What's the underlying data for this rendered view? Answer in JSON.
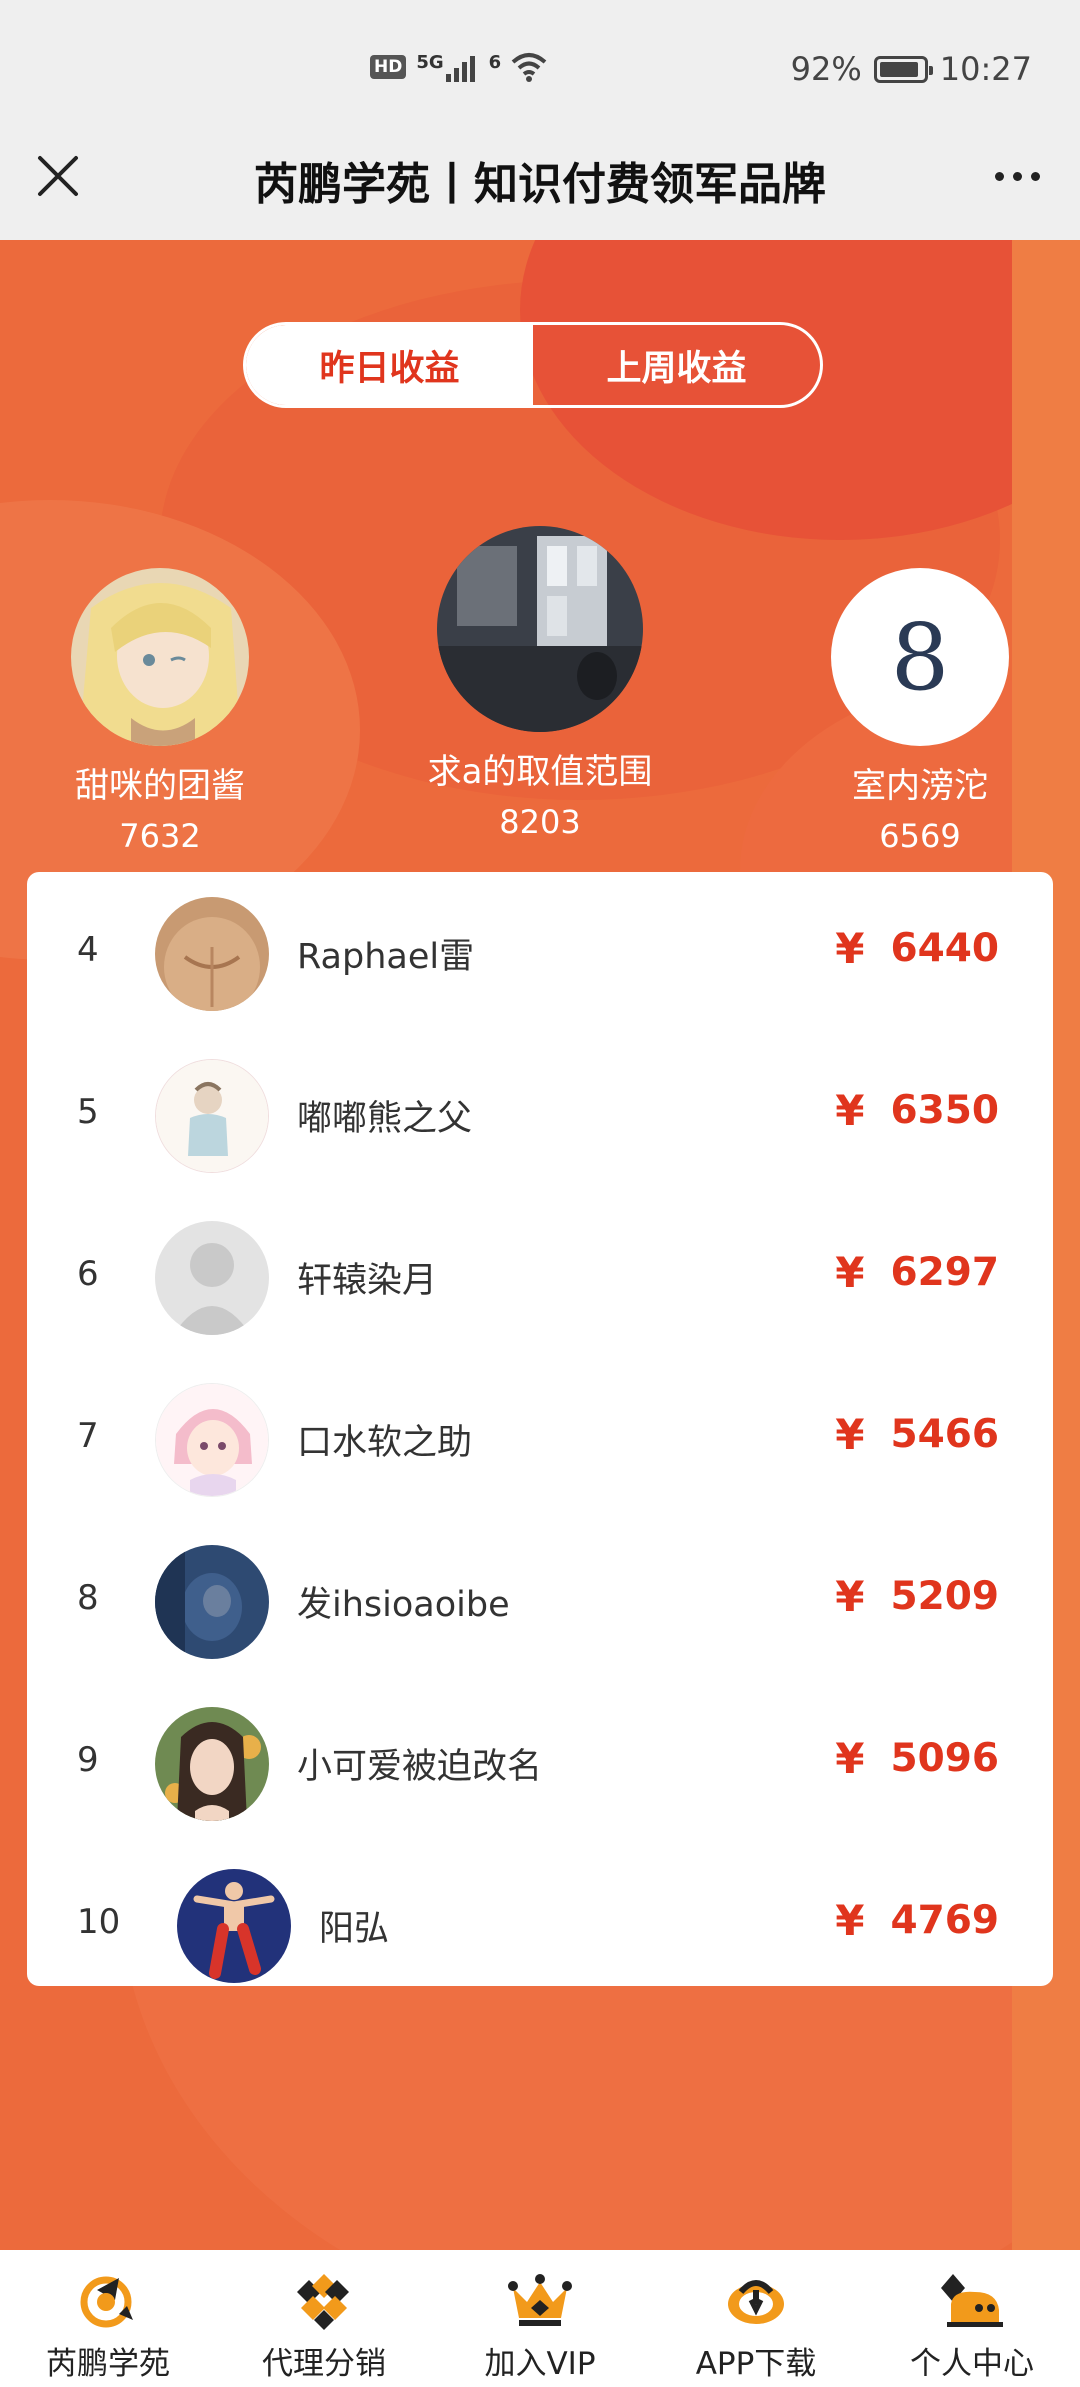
{
  "status_bar": {
    "hd": "HD",
    "network": "5G",
    "wifi": "6",
    "battery_percent": "92%",
    "battery_level": 0.92,
    "time": "10:27"
  },
  "title_bar": {
    "title": "芮鹏学苑丨知识付费领军品牌"
  },
  "tabs": [
    {
      "label": "昨日收益",
      "active": true
    },
    {
      "label": "上周收益",
      "active": false
    }
  ],
  "podium": {
    "first": {
      "name": "求a的取值范围",
      "score": "8203"
    },
    "second": {
      "name": "甜咪的团酱",
      "score": "7632"
    },
    "third": {
      "name": "室内滂沱",
      "score": "6569",
      "avatar_text": "8"
    }
  },
  "currency_symbol": "¥",
  "ranking": [
    {
      "rank": "4",
      "name": "Raphael雷",
      "amount": "6440"
    },
    {
      "rank": "5",
      "name": "嘟嘟熊之父",
      "amount": "6350"
    },
    {
      "rank": "6",
      "name": "轩辕染月",
      "amount": "6297"
    },
    {
      "rank": "7",
      "name": "口水软之助",
      "amount": "5466"
    },
    {
      "rank": "8",
      "name": "发ihsioaoibe",
      "amount": "5209"
    },
    {
      "rank": "9",
      "name": "小可爱被迫改名",
      "amount": "5096"
    },
    {
      "rank": "10",
      "name": "阳弘",
      "amount": "4769"
    }
  ],
  "bottom_nav": [
    {
      "label": "芮鹏学苑",
      "icon": "academy-icon"
    },
    {
      "label": "代理分销",
      "icon": "distribution-icon"
    },
    {
      "label": "加入VIP",
      "icon": "vip-crown-icon"
    },
    {
      "label": "APP下载",
      "icon": "app-download-icon"
    },
    {
      "label": "个人中心",
      "icon": "profile-icon"
    }
  ],
  "colors": {
    "accent": "#e0351d",
    "hero_orange": "#ec6a3c",
    "nav_orange": "#f29a1b"
  }
}
